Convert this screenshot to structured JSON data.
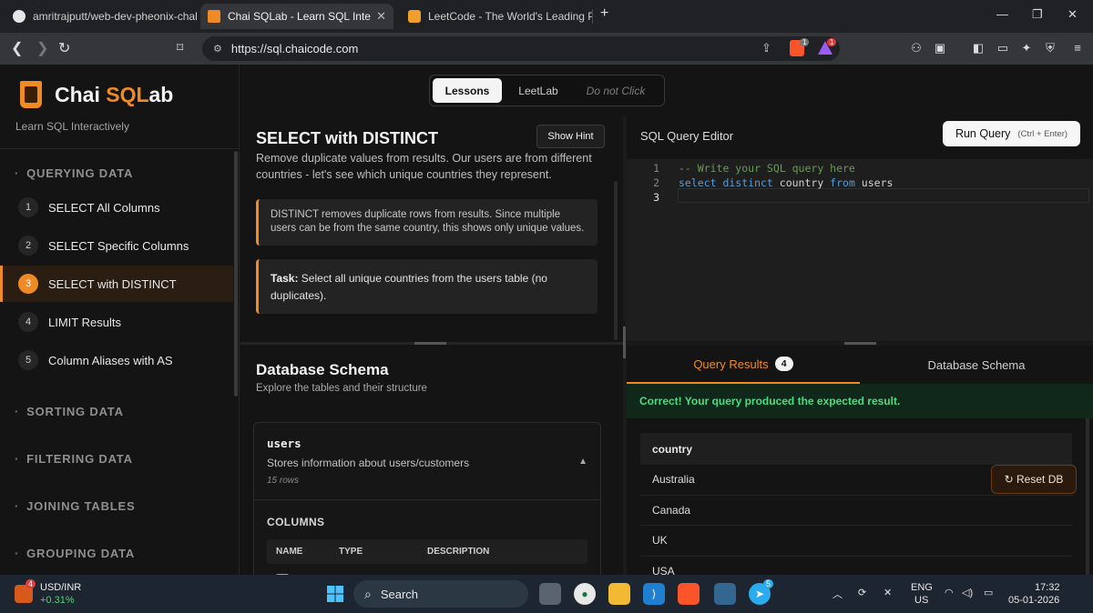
{
  "browser": {
    "tabs": [
      {
        "title": "amritrajputt/web-dev-pheonix-challe",
        "active": false
      },
      {
        "title": "Chai SQLab - Learn SQL Interactiv",
        "active": true
      },
      {
        "title": "LeetCode - The World's Leading Prog",
        "active": false
      }
    ],
    "new_tab": "+",
    "url": "https://sql.chaicode.com",
    "badge_shield": "1",
    "badge_alert": "1"
  },
  "app": {
    "brand_main": "Chai ",
    "brand_accent": "SQL",
    "brand_tail": "ab",
    "tagline": "Learn SQL Interactively",
    "modes": {
      "lessons": "Lessons",
      "leetlab": "LeetLab",
      "disabled": "Do not Click"
    },
    "accent_color": "#f08a24"
  },
  "sidebar": {
    "sections": [
      {
        "title": "QUERYING DATA"
      },
      {
        "title": "SORTING DATA"
      },
      {
        "title": "FILTERING DATA"
      },
      {
        "title": "JOINING TABLES"
      },
      {
        "title": "GROUPING DATA"
      }
    ],
    "lessons": [
      {
        "num": "1",
        "label": "SELECT All Columns"
      },
      {
        "num": "2",
        "label": "SELECT Specific Columns"
      },
      {
        "num": "3",
        "label": "SELECT with DISTINCT"
      },
      {
        "num": "4",
        "label": "LIMIT Results"
      },
      {
        "num": "5",
        "label": "Column Aliases with AS"
      }
    ]
  },
  "lesson": {
    "title": "SELECT with DISTINCT",
    "hint_button": "Show Hint",
    "description": "Remove duplicate values from results. Our users are from different countries - let's see which unique countries they represent.",
    "note": "DISTINCT removes duplicate rows from results. Since multiple users can be from the same country, this shows only unique values.",
    "task_label": "Task:",
    "task_text": " Select all unique countries from the users table (no duplicates)."
  },
  "schema": {
    "title": "Database Schema",
    "subtitle": "Explore the tables and their structure",
    "table_name": "users",
    "table_desc": "Stores information about users/customers",
    "table_rows": "15 rows",
    "collapse_icon": "▲",
    "columns_heading": "COLUMNS",
    "col_headers": {
      "name": "NAME",
      "type": "TYPE",
      "desc": "DESCRIPTION"
    }
  },
  "editor": {
    "title": "SQL Query Editor",
    "run_label": "Run Query",
    "run_shortcut": "(Ctrl + Enter)",
    "line_numbers": [
      "1",
      "2",
      "3"
    ],
    "line1": "-- Write your SQL query here",
    "line2_kw1": "select distinct",
    "line2_id1": " country ",
    "line2_kw2": "from",
    "line2_id2": " users"
  },
  "results": {
    "tab_results": "Query Results",
    "count": "4",
    "tab_schema": "Database Schema",
    "success": "Correct! Your query produced the expected result.",
    "column": "country",
    "rows": [
      "Australia",
      "Canada",
      "UK",
      "USA"
    ],
    "reset_label": "↻ Reset DB"
  },
  "taskbar": {
    "ticker_name": "USD/INR",
    "ticker_change": "+0.31%",
    "ticker_badge": "4",
    "search": "Search",
    "lang": "ENG",
    "region": "US",
    "time": "17:32",
    "date": "05-01-2026",
    "telegram_badge": "5"
  }
}
